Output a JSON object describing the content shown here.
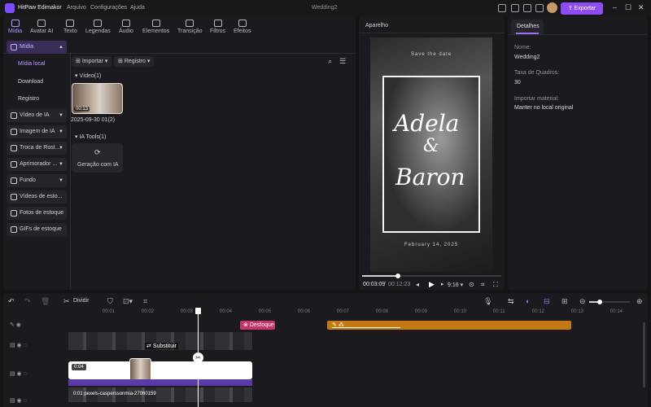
{
  "titlebar": {
    "app_name": "HitPaw Edimakor",
    "menu": [
      "Arquivo",
      "Configurações",
      "Ajuda"
    ],
    "project_name": "Wedding2",
    "export_label": "Exportar"
  },
  "tabs": [
    {
      "label": "Mídia",
      "icon": "media-icon",
      "active": true
    },
    {
      "label": "Avatar AI",
      "icon": "avatar-icon"
    },
    {
      "label": "Texto",
      "icon": "text-icon"
    },
    {
      "label": "Legendas",
      "icon": "subtitle-icon"
    },
    {
      "label": "Áudio",
      "icon": "audio-icon"
    },
    {
      "label": "Elementos",
      "icon": "elements-icon"
    },
    {
      "label": "Transição",
      "icon": "transition-icon"
    },
    {
      "label": "Filtros",
      "icon": "filter-icon"
    },
    {
      "label": "Efeitos",
      "icon": "effects-icon"
    }
  ],
  "sidebar": {
    "media": "Mídia",
    "media_sub": [
      "Mídia local",
      "Download",
      "Registro"
    ],
    "items": [
      {
        "label": "Vídeo de IA",
        "icon": "ai-video-icon"
      },
      {
        "label": "Imagem de IA",
        "icon": "ai-image-icon"
      },
      {
        "label": "Troca de Rost...",
        "icon": "face-swap-icon"
      },
      {
        "label": "Aprimorador ...",
        "icon": "enhancer-icon"
      },
      {
        "label": "Fundo",
        "icon": "background-icon"
      },
      {
        "label": "Vídeos de esto...",
        "icon": "stock-video-icon"
      },
      {
        "label": "Fotos de estoque",
        "icon": "stock-photo-icon"
      },
      {
        "label": "GIFs de estoque",
        "icon": "stock-gif-icon"
      }
    ]
  },
  "media": {
    "import_label": "Importar",
    "registry_label": "Registro",
    "video_section": "Vídeo(1)",
    "clip_name": "2025-09-30 01(2)",
    "clip_duration": "00:13",
    "ia_section": "IA Tools(1)",
    "ia_tool": "Geração com IA"
  },
  "preview": {
    "title": "Aparelho",
    "save_the_date": "Save the date",
    "names_line1": "Adela",
    "names_amp": "&",
    "names_line2": "Baron",
    "date": "February 14, 2025",
    "time_current": "00:03:09",
    "time_total": "00:12:23",
    "aspect": "9:16",
    "progress": 0.26
  },
  "details": {
    "tab": "Detalhes",
    "name_label": "Nome:",
    "name_value": "Wedding2",
    "fps_label": "Taxa de Quadros:",
    "fps_value": "30",
    "import_label": "Importar material:",
    "import_value": "Manter no local original"
  },
  "timeline": {
    "split_label": "Dividir",
    "ticks": [
      "00:01",
      "00:02",
      "00:03",
      "00:04",
      "00:05",
      "00:06",
      "00:07",
      "00:08",
      "00:09",
      "00:10",
      "00:11",
      "00:12",
      "00:13",
      "00:14"
    ],
    "effect_label": "Desfoque",
    "replace_label": "Substituir",
    "clip_overlay": "0:04",
    "bottom_clip": "0:01 pexels-casperssonmia-27060159"
  },
  "colors": {
    "accent": "#8e4cf7",
    "effect": "#c4356a",
    "orange": "#c47a12"
  }
}
